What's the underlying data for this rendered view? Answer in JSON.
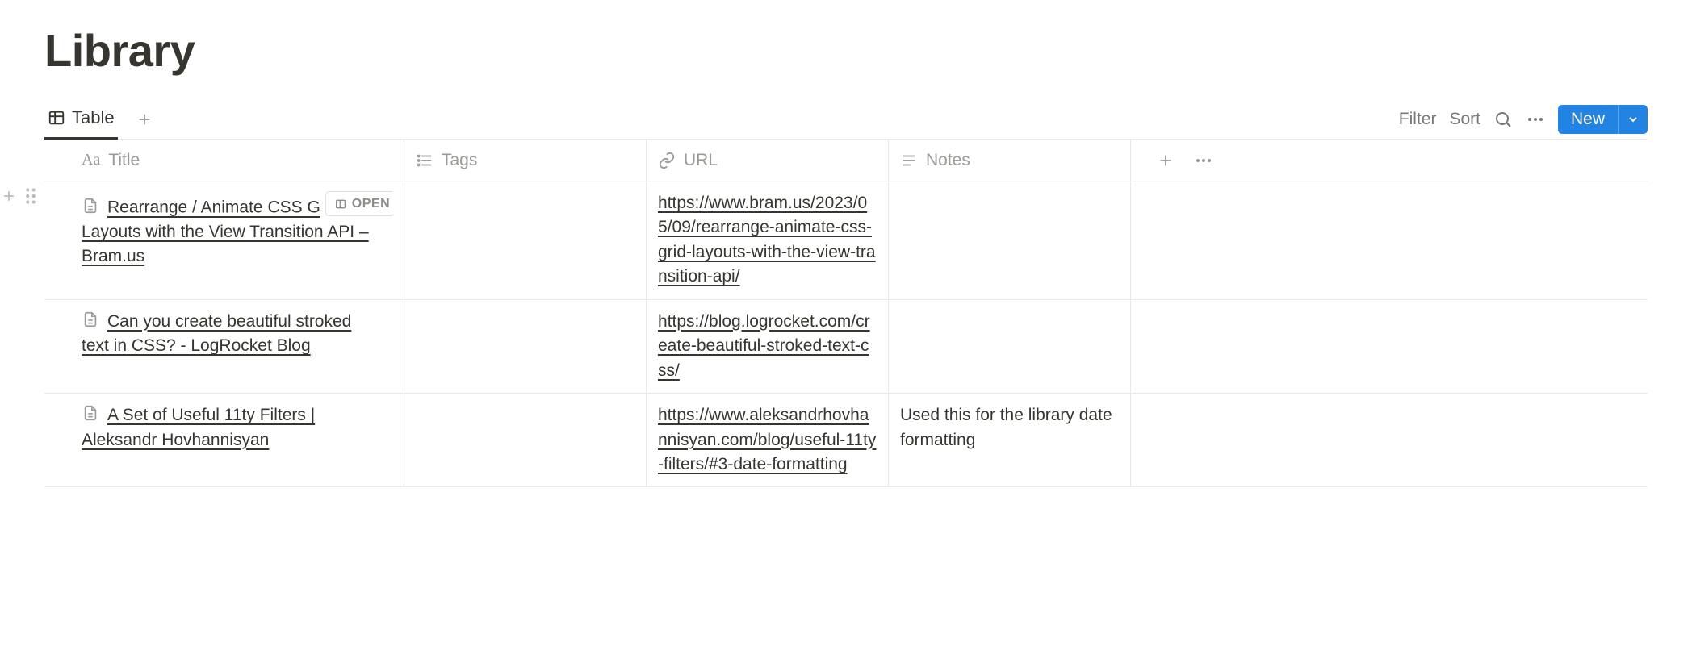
{
  "page": {
    "title": "Library"
  },
  "views": {
    "active": {
      "label": "Table"
    }
  },
  "toolbar": {
    "filter": "Filter",
    "sort": "Sort",
    "new": "New"
  },
  "columns": {
    "title": "Title",
    "tags": "Tags",
    "url": "URL",
    "notes": "Notes"
  },
  "open_label": "OPEN",
  "rows": [
    {
      "title_first": "Rearrange / Animate CSS G",
      "title_rest": "Layouts with the View Transition API – Bram.us",
      "tags": "",
      "url": "https://www.bram.us/2023/05/09/rearrange-animate-css-grid-layouts-with-the-view-transition-api/",
      "notes": "",
      "hovered": true
    },
    {
      "title_first": "Can you create beautiful stroked",
      "title_rest": "text in CSS? - LogRocket Blog",
      "tags": "",
      "url": "https://blog.logrocket.com/create-beautiful-stroked-text-css/",
      "notes": "",
      "hovered": false
    },
    {
      "title_first": "A Set of Useful 11ty Filters |",
      "title_rest": "Aleksandr Hovhannisyan",
      "tags": "",
      "url": "https://www.aleksandrhovhannisyan.com/blog/useful-11ty-filters/#3-date-formatting",
      "notes": "Used this for the library date formatting",
      "hovered": false
    }
  ]
}
